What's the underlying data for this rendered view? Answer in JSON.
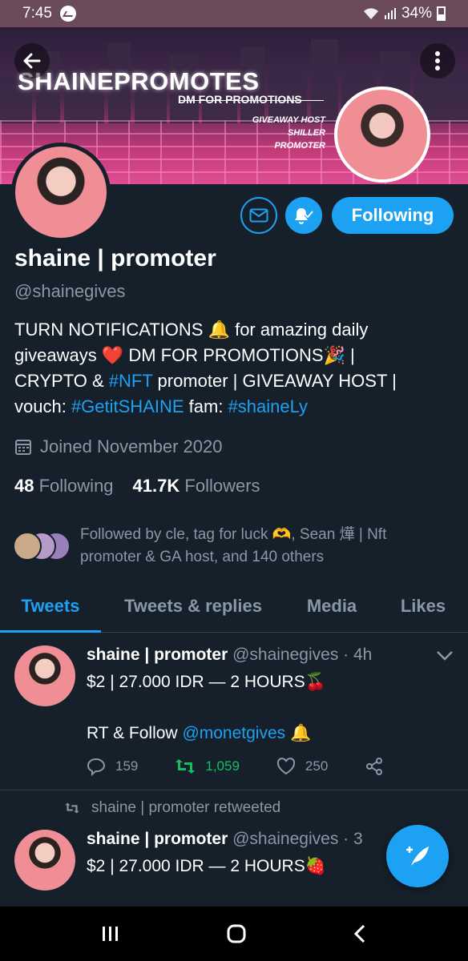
{
  "status_bar": {
    "time": "7:45",
    "battery": "34%"
  },
  "banner": {
    "brand": "SHAINEPROMOTES",
    "subtitle": "DM FOR PROMOTIONS",
    "tags": [
      "GIVEAWAY HOST",
      "SHILLER",
      "PROMOTER"
    ]
  },
  "profile": {
    "follow_label": "Following",
    "display_name": "shaine | promoter",
    "handle": "@shainegives",
    "bio": {
      "line1": "TURN NOTIFICATIONS 🔔 for amazing daily",
      "line2_a": "giveaways ❤️ DM FOR PROMOTIONS🎉 |",
      "line3_a": "CRYPTO & ",
      "line3_link": "#NFT",
      "line3_b": " promoter | GIVEAWAY HOST |",
      "line4_a": "vouch: ",
      "line4_link1": "#GetitSHAINE",
      "line4_b": " fam: ",
      "line4_link2": "#shaineLy"
    },
    "joined": "Joined November 2020",
    "following_count": "48",
    "following_label": "Following",
    "followers_count": "41.7K",
    "followers_label": "Followers",
    "followed_by": "Followed by cle, tag for luck 🫶, Sean 燁 | Nft promoter & GA host, and 140 others"
  },
  "tabs": [
    "Tweets",
    "Tweets & replies",
    "Media",
    "Likes"
  ],
  "tweets": [
    {
      "name": "shaine | promoter",
      "handle_time": "@shainegives · 4h",
      "line1": "$2 | 27.000 IDR — 2 HOURS🍒",
      "line2_a": "RT & Follow ",
      "line2_link": "@monetgives",
      "line2_b": " 🔔",
      "replies": "159",
      "retweets": "1,059",
      "likes": "250"
    },
    {
      "retweeted_by": "shaine | promoter retweeted",
      "name": "shaine | promoter",
      "handle_time": "@shainegives · 3",
      "line1": "$2 | 27.000 IDR — 2 HOURS🍓"
    }
  ],
  "colors": {
    "accent": "#1da1f2",
    "background": "#15202b",
    "muted": "#8899a6",
    "retweet_green": "#17bf63"
  }
}
